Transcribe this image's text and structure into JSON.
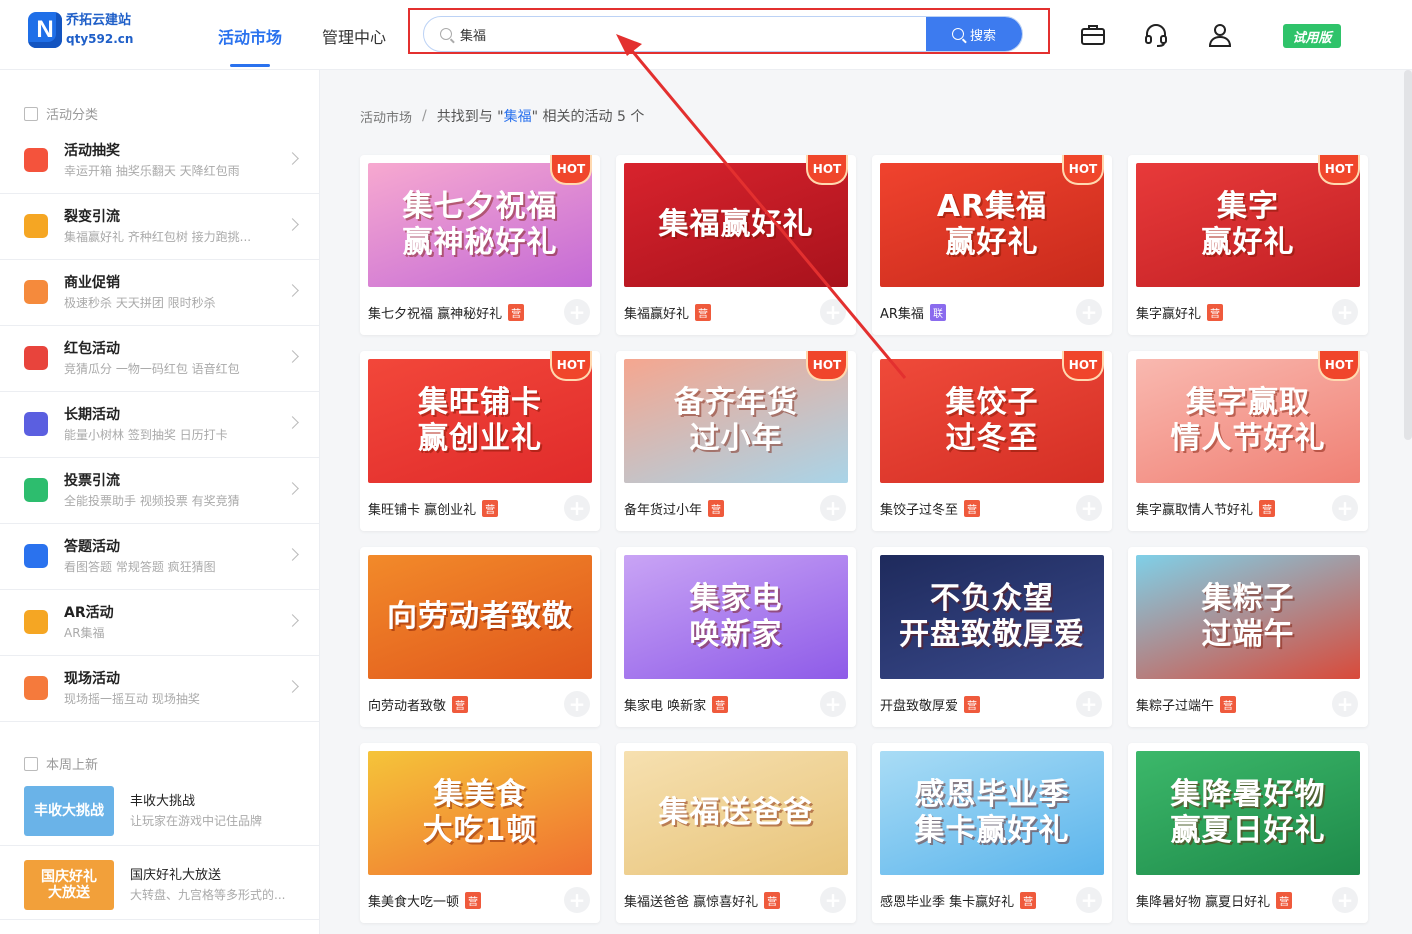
{
  "header": {
    "logo_name": "乔拓云建站",
    "logo_domain": "qty592.cn",
    "nav": [
      {
        "label": "活动市场",
        "active": true
      },
      {
        "label": "管理中心",
        "active": false
      }
    ],
    "search_value": "集福",
    "search_button": "搜索",
    "icons": [
      "briefcase-icon",
      "headset-icon",
      "user-icon"
    ],
    "trial_label": "试用版"
  },
  "sidebar": {
    "category_title": "活动分类",
    "categories": [
      {
        "name": "活动抽奖",
        "sub": "幸运开箱    抽奖乐翻天    天降红包雨",
        "icon": "gift-icon",
        "color": "#f4533c"
      },
      {
        "name": "裂变引流",
        "sub": "集福赢好礼    齐种红包树    接力跑挑...",
        "icon": "users-icon",
        "color": "#f5a623"
      },
      {
        "name": "商业促销",
        "sub": "极速秒杀    天天拼团    限时秒杀",
        "icon": "tag-icon",
        "color": "#f58a3c"
      },
      {
        "name": "红包活动",
        "sub": "竞猜瓜分    一物一码红包    语音红包",
        "icon": "envelope-icon",
        "color": "#e8443c"
      },
      {
        "name": "长期活动",
        "sub": "能量小树林    签到抽奖    日历打卡",
        "icon": "calendar-icon",
        "color": "#5b5fe0"
      },
      {
        "name": "投票引流",
        "sub": "全能投票助手    视频投票    有奖竞猜",
        "icon": "vote-icon",
        "color": "#2dbd6e"
      },
      {
        "name": "答题活动",
        "sub": "看图答题    常规答题    疯狂猜图",
        "icon": "question-icon",
        "color": "#2a72ee"
      },
      {
        "name": "AR活动",
        "sub": "AR集福",
        "icon": "ar-icon",
        "color": "#f5a623"
      },
      {
        "name": "现场活动",
        "sub": "现场摇一摇互动    现场抽奖",
        "icon": "screen-icon",
        "color": "#f57a3c"
      }
    ],
    "new_title": "本周上新",
    "new_items": [
      {
        "title": "丰收大挑战",
        "desc": "让玩家在游戏中记住品牌",
        "thumb": "丰收大挑战",
        "color": "#6ab3e8"
      },
      {
        "title": "国庆好礼大放送",
        "desc": "大转盘、九宫格等多形式的...",
        "thumb": "国庆好礼\n大放送",
        "color": "#f2a03a"
      }
    ]
  },
  "breadcrumb": {
    "root": "活动市场",
    "separator": "/",
    "prefix": "共找到与 \"",
    "keyword": "集福",
    "suffix": "\" 相关的活动 ",
    "count": "5",
    "unit": "个"
  },
  "cards": [
    {
      "title": "集七夕祝福 赢神秘好礼",
      "badge": "营",
      "hot": true,
      "art": "集七夕祝福\n赢神秘好礼",
      "bg": "#f7a9d0",
      "bg2": "#c46ad6"
    },
    {
      "title": "集福赢好礼",
      "badge": "营",
      "hot": true,
      "art": "集福赢好礼",
      "bg": "#d8232d",
      "bg2": "#a8121c"
    },
    {
      "title": "AR集福",
      "badge": "联",
      "hot": true,
      "art": "AR集福\n赢好礼",
      "bg": "#f0432e",
      "bg2": "#c82a1c"
    },
    {
      "title": "集字赢好礼",
      "badge": "营",
      "hot": true,
      "art": "集字\n赢好礼",
      "bg": "#e83a3a",
      "bg2": "#c22024"
    },
    {
      "title": "集旺铺卡 赢创业礼",
      "badge": "营",
      "hot": true,
      "art": "集旺铺卡\n赢创业礼",
      "bg": "#f2473a",
      "bg2": "#e02b2b"
    },
    {
      "title": "备年货过小年",
      "badge": "营",
      "hot": true,
      "art": "备齐年货\n过小年",
      "bg": "#f5a68f",
      "bg2": "#a9d4e8"
    },
    {
      "title": "集饺子过冬至",
      "badge": "营",
      "hot": true,
      "art": "集饺子\n过冬至",
      "bg": "#ef4a3a",
      "bg2": "#d42f25"
    },
    {
      "title": "集字赢取情人节好礼",
      "badge": "营",
      "hot": true,
      "art": "集字赢取\n情人节好礼",
      "bg": "#f9b9b0",
      "bg2": "#f08074"
    },
    {
      "title": "向劳动者致敬",
      "badge": "营",
      "hot": false,
      "art": "向劳动者致敬",
      "bg": "#f28a2a",
      "bg2": "#e0561c"
    },
    {
      "title": "集家电 唤新家",
      "badge": "营",
      "hot": false,
      "art": "集家电\n唤新家",
      "bg": "#c9a4f5",
      "bg2": "#8e5be8"
    },
    {
      "title": "开盘致敬厚爱",
      "badge": "营",
      "hot": false,
      "art": "不负众望\n开盘致敬厚爱",
      "bg": "#1e2a5c",
      "bg2": "#3a4a8c"
    },
    {
      "title": "集粽子过端午",
      "badge": "营",
      "hot": false,
      "art": "集粽子\n过端午",
      "bg": "#7fd0e8",
      "bg2": "#d94a3a"
    },
    {
      "title": "集美食大吃一顿",
      "badge": "营",
      "hot": false,
      "art": "集美食\n大吃1顿",
      "bg": "#f5c43a",
      "bg2": "#f07030"
    },
    {
      "title": "集福送爸爸 赢惊喜好礼",
      "badge": "营",
      "hot": false,
      "art": "集福送爸爸",
      "bg": "#f6e0b0",
      "bg2": "#e8c47a"
    },
    {
      "title": "感恩毕业季 集卡赢好礼",
      "badge": "营",
      "hot": false,
      "art": "感恩毕业季\n集卡赢好礼",
      "bg": "#a9dcf5",
      "bg2": "#5ab4ec"
    },
    {
      "title": "集降暑好物 赢夏日好礼",
      "badge": "营",
      "hot": false,
      "art": "集降暑好物\n赢夏日好礼",
      "bg": "#3cb86a",
      "bg2": "#1e8a4a"
    }
  ],
  "hot_label": "HOT",
  "plus_glyph": "+"
}
